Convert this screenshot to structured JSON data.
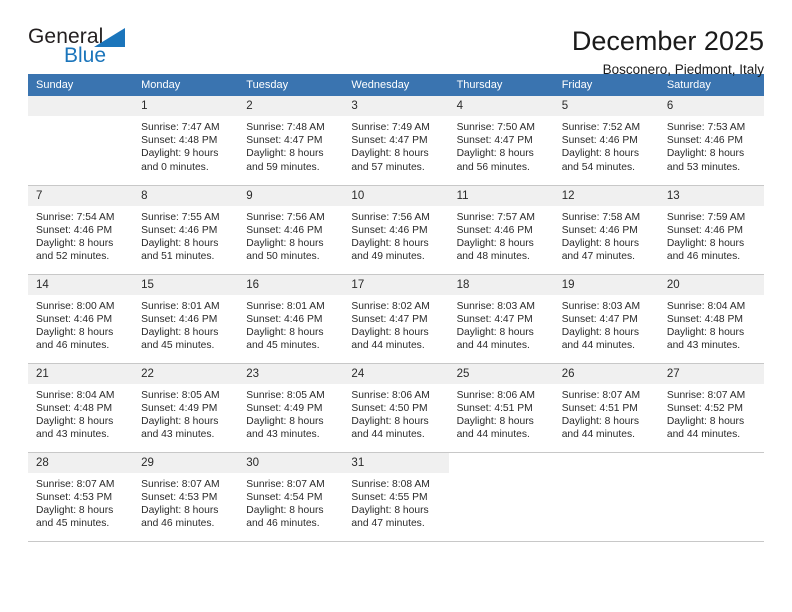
{
  "brand": {
    "name_part1": "General",
    "name_part2": "Blue",
    "logo_icon": "triangle-icon"
  },
  "header": {
    "title": "December 2025",
    "location": "Bosconero, Piedmont, Italy"
  },
  "colors": {
    "header_blue": "#3a74b0",
    "brand_blue": "#1b75bb",
    "daynum_band": "#f0f0f0",
    "grid_line": "#c8c8c8"
  },
  "weekdays": [
    "Sunday",
    "Monday",
    "Tuesday",
    "Wednesday",
    "Thursday",
    "Friday",
    "Saturday"
  ],
  "weeks": [
    [
      {
        "day": "",
        "empty": true,
        "sunrise": "",
        "sunset": "",
        "daylight1": "",
        "daylight2": ""
      },
      {
        "day": "1",
        "sunrise": "Sunrise: 7:47 AM",
        "sunset": "Sunset: 4:48 PM",
        "daylight1": "Daylight: 9 hours",
        "daylight2": "and 0 minutes."
      },
      {
        "day": "2",
        "sunrise": "Sunrise: 7:48 AM",
        "sunset": "Sunset: 4:47 PM",
        "daylight1": "Daylight: 8 hours",
        "daylight2": "and 59 minutes."
      },
      {
        "day": "3",
        "sunrise": "Sunrise: 7:49 AM",
        "sunset": "Sunset: 4:47 PM",
        "daylight1": "Daylight: 8 hours",
        "daylight2": "and 57 minutes."
      },
      {
        "day": "4",
        "sunrise": "Sunrise: 7:50 AM",
        "sunset": "Sunset: 4:47 PM",
        "daylight1": "Daylight: 8 hours",
        "daylight2": "and 56 minutes."
      },
      {
        "day": "5",
        "sunrise": "Sunrise: 7:52 AM",
        "sunset": "Sunset: 4:46 PM",
        "daylight1": "Daylight: 8 hours",
        "daylight2": "and 54 minutes."
      },
      {
        "day": "6",
        "sunrise": "Sunrise: 7:53 AM",
        "sunset": "Sunset: 4:46 PM",
        "daylight1": "Daylight: 8 hours",
        "daylight2": "and 53 minutes."
      }
    ],
    [
      {
        "day": "7",
        "sunrise": "Sunrise: 7:54 AM",
        "sunset": "Sunset: 4:46 PM",
        "daylight1": "Daylight: 8 hours",
        "daylight2": "and 52 minutes."
      },
      {
        "day": "8",
        "sunrise": "Sunrise: 7:55 AM",
        "sunset": "Sunset: 4:46 PM",
        "daylight1": "Daylight: 8 hours",
        "daylight2": "and 51 minutes."
      },
      {
        "day": "9",
        "sunrise": "Sunrise: 7:56 AM",
        "sunset": "Sunset: 4:46 PM",
        "daylight1": "Daylight: 8 hours",
        "daylight2": "and 50 minutes."
      },
      {
        "day": "10",
        "sunrise": "Sunrise: 7:56 AM",
        "sunset": "Sunset: 4:46 PM",
        "daylight1": "Daylight: 8 hours",
        "daylight2": "and 49 minutes."
      },
      {
        "day": "11",
        "sunrise": "Sunrise: 7:57 AM",
        "sunset": "Sunset: 4:46 PM",
        "daylight1": "Daylight: 8 hours",
        "daylight2": "and 48 minutes."
      },
      {
        "day": "12",
        "sunrise": "Sunrise: 7:58 AM",
        "sunset": "Sunset: 4:46 PM",
        "daylight1": "Daylight: 8 hours",
        "daylight2": "and 47 minutes."
      },
      {
        "day": "13",
        "sunrise": "Sunrise: 7:59 AM",
        "sunset": "Sunset: 4:46 PM",
        "daylight1": "Daylight: 8 hours",
        "daylight2": "and 46 minutes."
      }
    ],
    [
      {
        "day": "14",
        "sunrise": "Sunrise: 8:00 AM",
        "sunset": "Sunset: 4:46 PM",
        "daylight1": "Daylight: 8 hours",
        "daylight2": "and 46 minutes."
      },
      {
        "day": "15",
        "sunrise": "Sunrise: 8:01 AM",
        "sunset": "Sunset: 4:46 PM",
        "daylight1": "Daylight: 8 hours",
        "daylight2": "and 45 minutes."
      },
      {
        "day": "16",
        "sunrise": "Sunrise: 8:01 AM",
        "sunset": "Sunset: 4:46 PM",
        "daylight1": "Daylight: 8 hours",
        "daylight2": "and 45 minutes."
      },
      {
        "day": "17",
        "sunrise": "Sunrise: 8:02 AM",
        "sunset": "Sunset: 4:47 PM",
        "daylight1": "Daylight: 8 hours",
        "daylight2": "and 44 minutes."
      },
      {
        "day": "18",
        "sunrise": "Sunrise: 8:03 AM",
        "sunset": "Sunset: 4:47 PM",
        "daylight1": "Daylight: 8 hours",
        "daylight2": "and 44 minutes."
      },
      {
        "day": "19",
        "sunrise": "Sunrise: 8:03 AM",
        "sunset": "Sunset: 4:47 PM",
        "daylight1": "Daylight: 8 hours",
        "daylight2": "and 44 minutes."
      },
      {
        "day": "20",
        "sunrise": "Sunrise: 8:04 AM",
        "sunset": "Sunset: 4:48 PM",
        "daylight1": "Daylight: 8 hours",
        "daylight2": "and 43 minutes."
      }
    ],
    [
      {
        "day": "21",
        "sunrise": "Sunrise: 8:04 AM",
        "sunset": "Sunset: 4:48 PM",
        "daylight1": "Daylight: 8 hours",
        "daylight2": "and 43 minutes."
      },
      {
        "day": "22",
        "sunrise": "Sunrise: 8:05 AM",
        "sunset": "Sunset: 4:49 PM",
        "daylight1": "Daylight: 8 hours",
        "daylight2": "and 43 minutes."
      },
      {
        "day": "23",
        "sunrise": "Sunrise: 8:05 AM",
        "sunset": "Sunset: 4:49 PM",
        "daylight1": "Daylight: 8 hours",
        "daylight2": "and 43 minutes."
      },
      {
        "day": "24",
        "sunrise": "Sunrise: 8:06 AM",
        "sunset": "Sunset: 4:50 PM",
        "daylight1": "Daylight: 8 hours",
        "daylight2": "and 44 minutes."
      },
      {
        "day": "25",
        "sunrise": "Sunrise: 8:06 AM",
        "sunset": "Sunset: 4:51 PM",
        "daylight1": "Daylight: 8 hours",
        "daylight2": "and 44 minutes."
      },
      {
        "day": "26",
        "sunrise": "Sunrise: 8:07 AM",
        "sunset": "Sunset: 4:51 PM",
        "daylight1": "Daylight: 8 hours",
        "daylight2": "and 44 minutes."
      },
      {
        "day": "27",
        "sunrise": "Sunrise: 8:07 AM",
        "sunset": "Sunset: 4:52 PM",
        "daylight1": "Daylight: 8 hours",
        "daylight2": "and 44 minutes."
      }
    ],
    [
      {
        "day": "28",
        "sunrise": "Sunrise: 8:07 AM",
        "sunset": "Sunset: 4:53 PM",
        "daylight1": "Daylight: 8 hours",
        "daylight2": "and 45 minutes."
      },
      {
        "day": "29",
        "sunrise": "Sunrise: 8:07 AM",
        "sunset": "Sunset: 4:53 PM",
        "daylight1": "Daylight: 8 hours",
        "daylight2": "and 46 minutes."
      },
      {
        "day": "30",
        "sunrise": "Sunrise: 8:07 AM",
        "sunset": "Sunset: 4:54 PM",
        "daylight1": "Daylight: 8 hours",
        "daylight2": "and 46 minutes."
      },
      {
        "day": "31",
        "sunrise": "Sunrise: 8:08 AM",
        "sunset": "Sunset: 4:55 PM",
        "daylight1": "Daylight: 8 hours",
        "daylight2": "and 47 minutes."
      },
      {
        "day": "",
        "empty": true,
        "blank": true,
        "sunrise": "",
        "sunset": "",
        "daylight1": "",
        "daylight2": ""
      },
      {
        "day": "",
        "empty": true,
        "blank": true,
        "sunrise": "",
        "sunset": "",
        "daylight1": "",
        "daylight2": ""
      },
      {
        "day": "",
        "empty": true,
        "blank": true,
        "sunrise": "",
        "sunset": "",
        "daylight1": "",
        "daylight2": ""
      }
    ]
  ]
}
